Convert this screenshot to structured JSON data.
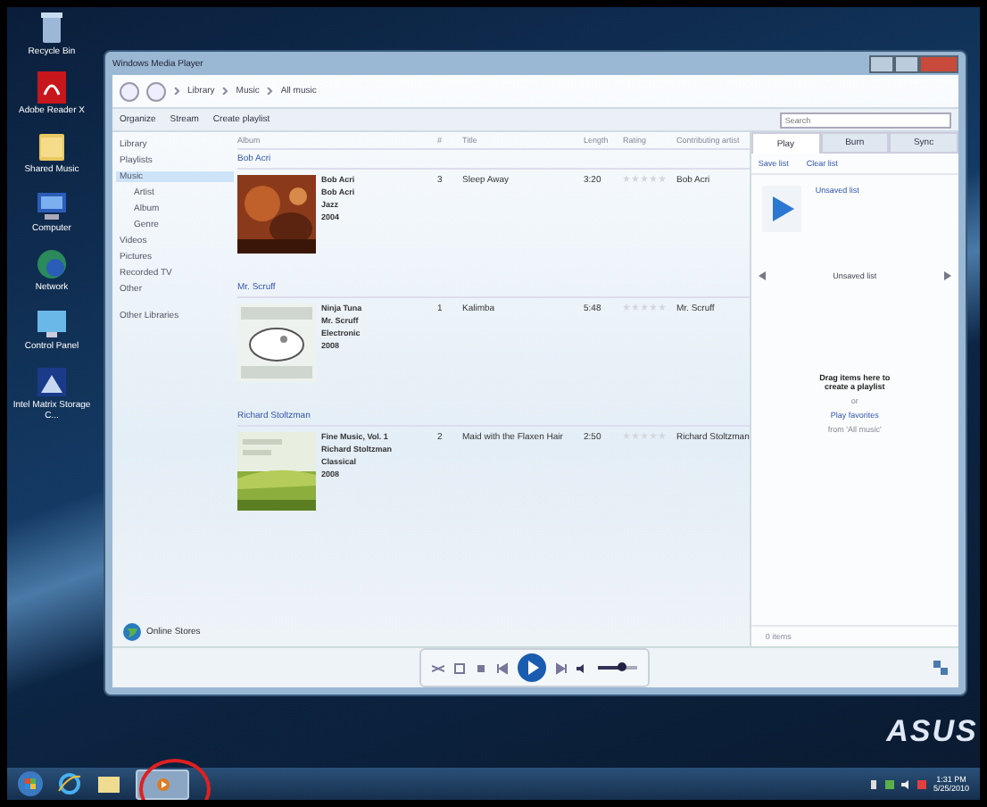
{
  "desktop_icons": [
    {
      "label": "Recycle Bin"
    },
    {
      "label": "Adobe Reader X"
    },
    {
      "label": "Shared Music"
    },
    {
      "label": "Computer"
    },
    {
      "label": "Network"
    },
    {
      "label": "Control Panel"
    },
    {
      "label": "Intel Matrix Storage C..."
    }
  ],
  "window": {
    "title": "Windows Media Player"
  },
  "breadcrumb": [
    "Library",
    "Music",
    "All music"
  ],
  "toolbar": [
    "Organize",
    "Stream",
    "Create playlist"
  ],
  "search": {
    "placeholder": "Search"
  },
  "nav": [
    {
      "label": "Library",
      "selected": false
    },
    {
      "label": "Playlists",
      "selected": false
    },
    {
      "label": "Music",
      "selected": true,
      "children": [
        {
          "label": "Artist",
          "selected": false
        },
        {
          "label": "Album",
          "selected": false
        },
        {
          "label": "Genre",
          "selected": false
        }
      ]
    },
    {
      "label": "Videos",
      "selected": false
    },
    {
      "label": "Pictures",
      "selected": false
    },
    {
      "label": "Recorded TV",
      "selected": false
    },
    {
      "label": "Other",
      "selected": false
    },
    {
      "label": "Other Libraries",
      "selected": false
    }
  ],
  "columns": [
    "Album",
    "#",
    "Title",
    "Length",
    "Rating",
    "Contributing artist"
  ],
  "groups": [
    {
      "header": "Bob Acri",
      "album": [
        "Bob Acri",
        "Bob Acri",
        "Jazz",
        "2004"
      ],
      "track": "3",
      "title": "Sleep Away",
      "length": "3:20",
      "stars": 0,
      "artist": "Bob Acri"
    },
    {
      "header": "Mr. Scruff",
      "album": [
        "Ninja Tuna",
        "Mr. Scruff",
        "Electronic",
        "2008"
      ],
      "track": "1",
      "title": "Kalimba",
      "length": "5:48",
      "stars": 0,
      "artist": "Mr. Scruff"
    },
    {
      "header": "Richard Stoltzman",
      "album": [
        "Fine Music, Vol. 1",
        "Richard Stoltzman",
        "Classical",
        "2008"
      ],
      "track": "2",
      "title": "Maid with the Flaxen Hair",
      "length": "2:50",
      "stars": 0,
      "artist": "Richard Stoltzman"
    }
  ],
  "online_stores": "Online Stores",
  "tabs": [
    {
      "label": "Play",
      "selected": true
    },
    {
      "label": "Burn",
      "selected": false
    },
    {
      "label": "Sync",
      "selected": false
    }
  ],
  "list_actions": [
    "Save list",
    "Clear list"
  ],
  "list_link": "Unsaved list",
  "list_header": "Unsaved list",
  "drag_text": "Drag items here to create a playlist",
  "or": "or",
  "favorites_link": "Play favorites",
  "favorites_from": "from 'All music'",
  "items_count": "0 items",
  "volume": {
    "level": 0.6
  },
  "wallpaper_logo": "ASUS",
  "clock": {
    "time": "1:31 PM",
    "date": "5/25/2010"
  }
}
